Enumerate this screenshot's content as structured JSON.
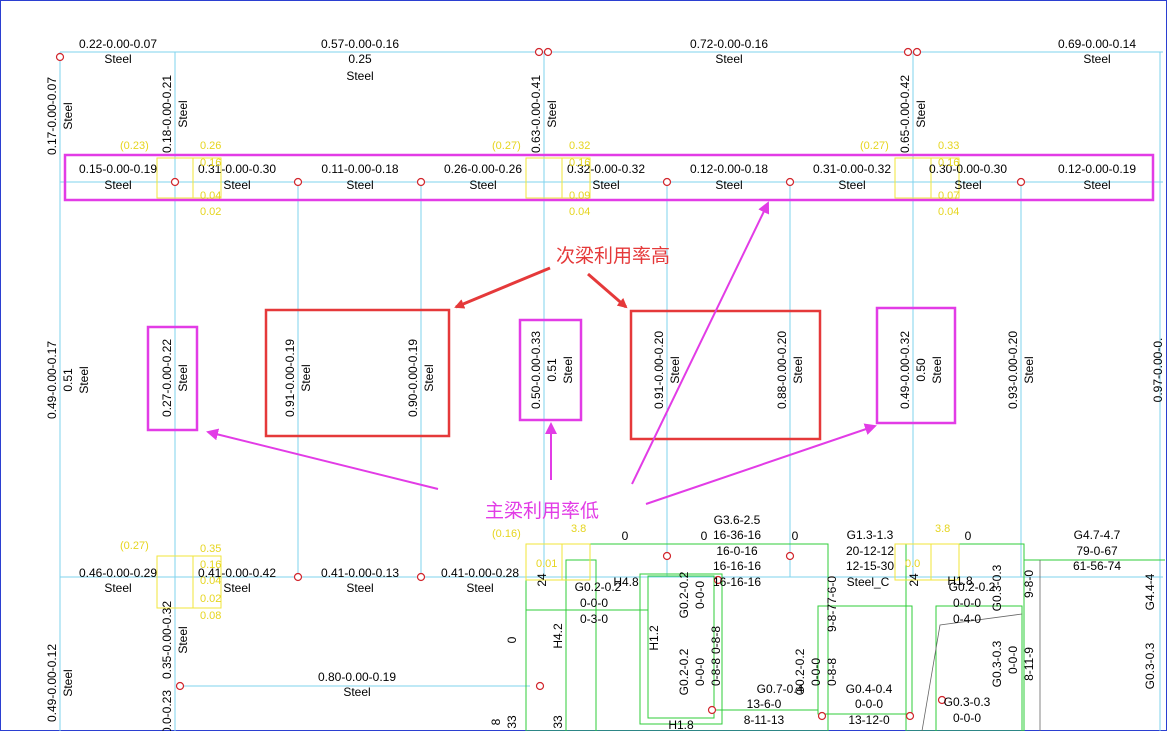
{
  "colors": {
    "background": "#ffffff",
    "beam_line": "#7fd3ee",
    "text": "#000000",
    "yellow": "#f2e63a",
    "green": "#2fce3a",
    "magenta": "#e23ce6",
    "red": "#e5393a",
    "node": "#d1252c",
    "frame": "#2b3fd1"
  },
  "annotations": {
    "secondary_high": "次梁利用率高",
    "primary_low": "主梁利用率低"
  },
  "top_beams": [
    {
      "value": "0.22-0.00-0.07",
      "material": "Steel",
      "extra": ""
    },
    {
      "value": "0.57-0.00-0.16",
      "material": "Steel",
      "extra": "0.25"
    },
    {
      "value": "0.72-0.00-0.16",
      "material": "Steel",
      "extra": ""
    },
    {
      "value": "0.69-0.00-0.14",
      "material": "Steel",
      "extra": ""
    }
  ],
  "upper_columns": [
    {
      "value": "0.17-0.00-0.07",
      "material": "Steel"
    },
    {
      "value": "0.18-0.00-0.21",
      "material": "Steel"
    },
    {
      "value": "0.63-0.00-0.41",
      "material": "Steel"
    },
    {
      "value": "0.65-0.00-0.42",
      "material": "Steel"
    }
  ],
  "row_beams": [
    {
      "value": "0.15-0.00-0.19",
      "material": "Steel"
    },
    {
      "value": "0.31-0.00-0.30",
      "material": "Steel"
    },
    {
      "value": "0.11-0.00-0.18",
      "material": "Steel"
    },
    {
      "value": "0.26-0.00-0.26",
      "material": "Steel"
    },
    {
      "value": "0.32-0.00-0.32",
      "material": "Steel"
    },
    {
      "value": "0.12-0.00-0.18",
      "material": "Steel"
    },
    {
      "value": "0.31-0.00-0.32",
      "material": "Steel"
    },
    {
      "value": "0.30-0.00-0.30",
      "material": "Steel"
    },
    {
      "value": "0.12-0.00-0.19",
      "material": "Steel"
    }
  ],
  "yellow_labels": {
    "g1_paren": "(0.23)",
    "g1_vals": [
      "0.26",
      "0.16",
      "0.04",
      "0.02"
    ],
    "g2_paren": "(0.27)",
    "g2_vals": [
      "0.32",
      "0.16",
      "0.09",
      "0.04"
    ],
    "g3_paren": "(0.27)",
    "g3_vals": [
      "0.33",
      "0.16",
      "0.07",
      "0.04"
    ],
    "g4_paren": "(0.27)",
    "g4_vals": [
      "0.35",
      "0.16",
      "0.04",
      "0.02",
      "0.08"
    ],
    "g5_paren": "(0.16)",
    "g5_val": "3.8",
    "g5_small": "0.01",
    "g6_val": "3.8",
    "g6_small": "0.0"
  },
  "mid_members": [
    {
      "value": "0.49-0.00-0.17",
      "extra": "0.51",
      "material": "Steel"
    },
    {
      "value": "0.27-0.00-0.22",
      "extra": "",
      "material": "Steel"
    },
    {
      "value": "0.91-0.00-0.19",
      "extra": "",
      "material": "Steel"
    },
    {
      "value": "0.90-0.00-0.19",
      "extra": "",
      "material": "Steel"
    },
    {
      "value": "0.50-0.00-0.33",
      "extra": "0.51",
      "material": "Steel"
    },
    {
      "value": "0.91-0.00-0.20",
      "extra": "",
      "material": "Steel"
    },
    {
      "value": "0.88-0.00-0.20",
      "extra": "",
      "material": "Steel"
    },
    {
      "value": "0.49-0.00-0.32",
      "extra": "0.50",
      "material": "Steel"
    },
    {
      "value": "0.93-0.00-0.20",
      "extra": "",
      "material": "Steel"
    },
    {
      "value": "0.97-0.00-0.",
      "extra": "",
      "material": ""
    }
  ],
  "bottom_beams": [
    {
      "value": "0.46-0.00-0.29",
      "material": "Steel"
    },
    {
      "value": "0.41-0.00-0.42",
      "material": "Steel"
    },
    {
      "value": "0.41-0.00-0.13",
      "material": "Steel"
    },
    {
      "value": "0.41-0.00-0.28",
      "material": "Steel"
    },
    {
      "value": "0.80-0.00-0.19",
      "material": "Steel"
    }
  ],
  "bottom_columns": [
    {
      "value": "0.35-0.00-0.32",
      "material": "Steel"
    },
    {
      "value": "0.49-0.00-0.12",
      "material": "Steel"
    },
    {
      "value": "0.0-0.23",
      "material": ""
    }
  ],
  "concrete": {
    "g36": "G3.6-2.5",
    "r1": "16-36-16",
    "r2": "16-0-16",
    "r3": "16-16-16",
    "r4": "16-16-16",
    "g13": "G1.3-1.3",
    "r5": "20-12-12",
    "r6": "12-15-30",
    "steel_c": "Steel_C",
    "g47": "G4.7-4.7",
    "r7": "79-0-67",
    "r8": "61-56-74",
    "g02a": "G0.2-0.2",
    "r9": "0-0-0",
    "r10": "0-3-0",
    "h48": "H4.8",
    "h42": "H4.2",
    "h12": "H1.2",
    "h18": "H1.8",
    "h18b": "H1.8",
    "g07": "G0.7-0.4",
    "r11": "13-6-0",
    "r12": "8-11-13",
    "g04": "G0.4-0.4",
    "r13": "0-0-0",
    "r14": "13-12-0",
    "g02b": "G0.2-0.2",
    "r15": "0-0-0",
    "r16": "0-4-0",
    "g03a": "G0.3-0.3",
    "r17": "0-0-0",
    "g03b": "G0.3-0.3",
    "r18": "0-0-0",
    "r19": "8-11-9",
    "g44": "G4.4-4",
    "g03c": "G0.3-0.3",
    "zero": "0",
    "v1": "G0.2-0.2",
    "v2": "0-0-0",
    "v3": "0-8-8",
    "v4": "G0.2-0.2",
    "v5": "0-0-0",
    "v6": "0-8-8",
    "v7": "9-8-77-6-0",
    "v8": "0-8-8",
    "v9": "9-8-0",
    "n33": "33",
    "n8": "8",
    "n24": "24"
  }
}
